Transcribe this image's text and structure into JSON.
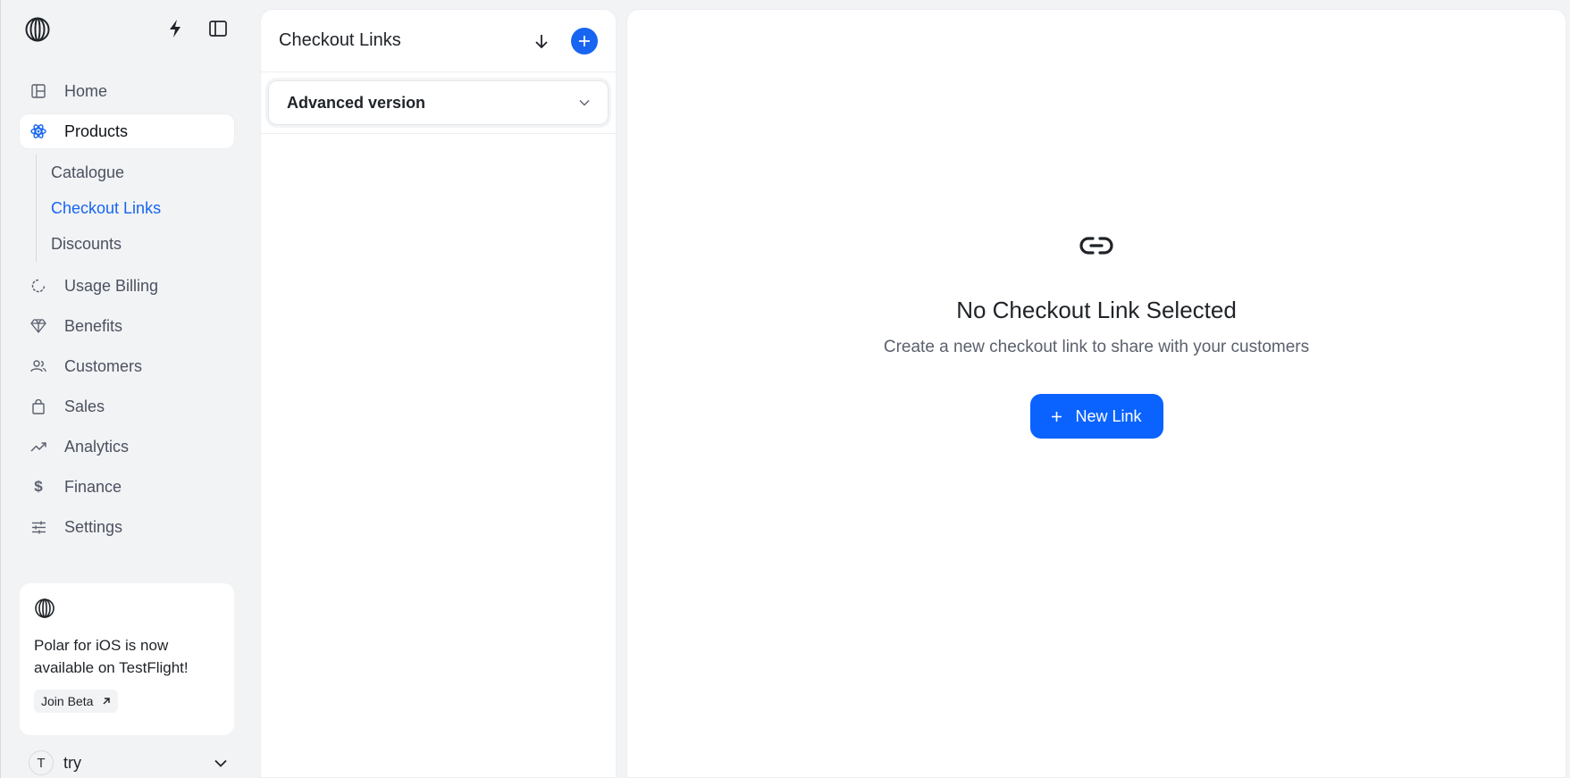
{
  "sidebar": {
    "nav": [
      {
        "label": "Home",
        "icon": "home-icon"
      },
      {
        "label": "Products",
        "icon": "products-icon",
        "active": true
      },
      {
        "label": "Usage Billing",
        "icon": "usage-icon"
      },
      {
        "label": "Benefits",
        "icon": "diamond-icon"
      },
      {
        "label": "Customers",
        "icon": "users-icon"
      },
      {
        "label": "Sales",
        "icon": "bag-icon"
      },
      {
        "label": "Analytics",
        "icon": "trend-icon"
      },
      {
        "label": "Finance",
        "icon": "dollar-icon"
      },
      {
        "label": "Settings",
        "icon": "sliders-icon"
      }
    ],
    "subnav": [
      {
        "label": "Catalogue"
      },
      {
        "label": "Checkout Links",
        "active": true
      },
      {
        "label": "Discounts"
      }
    ],
    "promo": {
      "text": "Polar for iOS is now available on TestFlight!",
      "button": "Join Beta"
    },
    "account": {
      "initial": "T",
      "name": "try"
    }
  },
  "list": {
    "title": "Checkout Links",
    "filter": "Advanced version"
  },
  "main": {
    "empty_title": "No Checkout Link Selected",
    "empty_subtitle": "Create a new checkout link to share with your customers",
    "new_button": "New Link"
  },
  "colors": {
    "accent": "#1765f1",
    "button": "#0a63ff",
    "background": "#f2f3f5"
  }
}
